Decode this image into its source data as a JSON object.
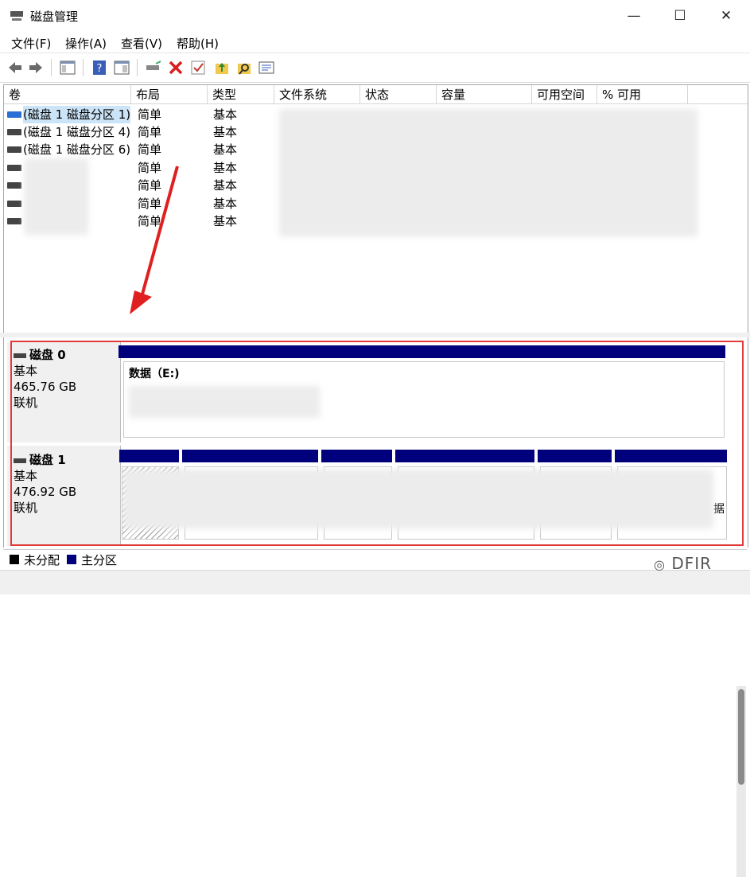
{
  "window": {
    "title": "磁盘管理",
    "min": "—",
    "max": "☐",
    "close": "✕"
  },
  "menu": [
    "文件(F)",
    "操作(A)",
    "查看(V)",
    "帮助(H)"
  ],
  "toolbar_icons": [
    "back-arrow-icon",
    "forward-arrow-icon",
    "console-tree-icon",
    "help-icon",
    "view-icon",
    "connect-drive-icon",
    "delete-icon",
    "check-icon",
    "folder-up-icon",
    "search-folder-icon",
    "properties-icon"
  ],
  "columns": [
    "卷",
    "布局",
    "类型",
    "文件系统",
    "状态",
    "容量",
    "可用空间",
    "% 可用"
  ],
  "volumes": [
    {
      "name": "(磁盘 1 磁盘分区 1)",
      "layout": "简单",
      "type": "基本",
      "selected": true
    },
    {
      "name": "(磁盘 1 磁盘分区 4)",
      "layout": "简单",
      "type": "基本",
      "selected": false
    },
    {
      "name": "(磁盘 1 磁盘分区 6)",
      "layout": "简单",
      "type": "基本",
      "selected": false
    },
    {
      "name": "",
      "layout": "简单",
      "type": "基本",
      "selected": false
    },
    {
      "name": "",
      "layout": "简单",
      "type": "基本",
      "selected": false
    },
    {
      "name": "",
      "layout": "简单",
      "type": "基本",
      "selected": false
    },
    {
      "name": "",
      "layout": "简单",
      "type": "基本",
      "selected": false
    }
  ],
  "disks": [
    {
      "name": "磁盘 0",
      "kind": "基本",
      "size": "465.76 GB",
      "status": "联机",
      "partition_label": "数据（E:)"
    },
    {
      "name": "磁盘 1",
      "kind": "基本",
      "size": "476.92 GB",
      "status": "联机",
      "partition_tail": "据"
    }
  ],
  "legend": {
    "unallocated": "未分配",
    "primary": "主分区",
    "unallocated_color": "#000000",
    "primary_color": "#00007d"
  },
  "watermark": "DFIR",
  "colors": {
    "accent": "#00007d",
    "selection": "#cce4f7",
    "highlight_box": "#e23a3a"
  }
}
